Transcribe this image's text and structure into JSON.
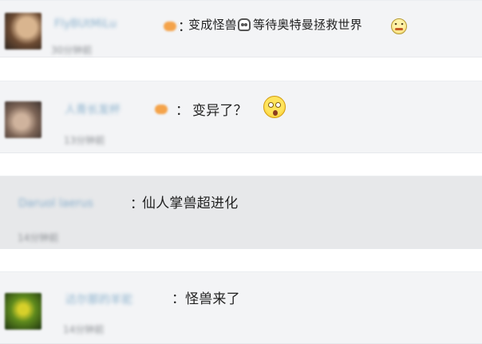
{
  "comments": [
    {
      "username": "FlyBUtMiLu",
      "separator": "：",
      "message": "变成怪兽",
      "message_after_emoji": "等待奥特曼拯救世界",
      "time": "30分钟前",
      "emojis": [
        "skull-emoji",
        "nervous-emoji"
      ],
      "has_badge": true
    },
    {
      "username": "人青长发杯",
      "separator": "：",
      "message": "变异了？",
      "time": "13分钟前",
      "emojis": [
        "surprised-emoji"
      ],
      "has_badge": true
    },
    {
      "username": "Daruol laerus",
      "separator": "：",
      "message": "仙人掌兽超进化",
      "time": "14分钟前",
      "emojis": [],
      "has_badge": false
    },
    {
      "username": "达尔那的羊驼",
      "separator": "：",
      "message": "怪兽来了",
      "time": "14分钟前",
      "emojis": [],
      "has_badge": false
    }
  ]
}
